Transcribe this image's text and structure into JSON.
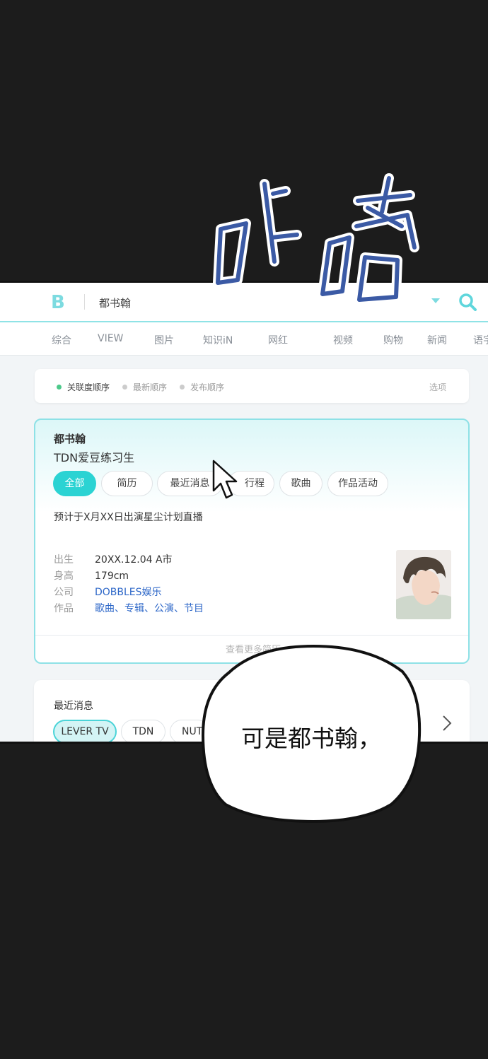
{
  "header": {
    "logo": "B",
    "query": "都书翰"
  },
  "tabs": [
    "综合",
    "VIEW",
    "图片",
    "知识iN",
    "网红",
    "视频",
    "购物",
    "新闻",
    "语字"
  ],
  "sort": {
    "items": [
      "关联度顺序",
      "最新顺序",
      "发布顺序"
    ],
    "options_label": "选项"
  },
  "profile": {
    "name": "都书翰",
    "subtitle": "TDN爱豆练习生",
    "chips": [
      "全部",
      "简历",
      "最近消息",
      "行程",
      "歌曲",
      "作品活动"
    ],
    "notice": "预计于X月XX日出演星尘计划直播",
    "info": [
      {
        "key": "出生",
        "value": "20XX.12.04 A市"
      },
      {
        "key": "身高",
        "value": "179cm"
      },
      {
        "key": "公司",
        "value": "DOBBLES娱乐"
      },
      {
        "key": "作品",
        "value": "歌曲、专辑、公演、节目"
      }
    ],
    "more": "查看更多简历"
  },
  "news": {
    "title": "最近消息",
    "chips": [
      "LEVER TV",
      "TDN",
      "NUT"
    ]
  },
  "sfx": "咔嗒",
  "speech": "可是都书翰，",
  "colors": {
    "accent": "#2bd3d3",
    "border": "#8ee1e6",
    "link": "#2d67c8",
    "sfx_fill": "#3b5aa5",
    "background": "#1c1c1c"
  }
}
